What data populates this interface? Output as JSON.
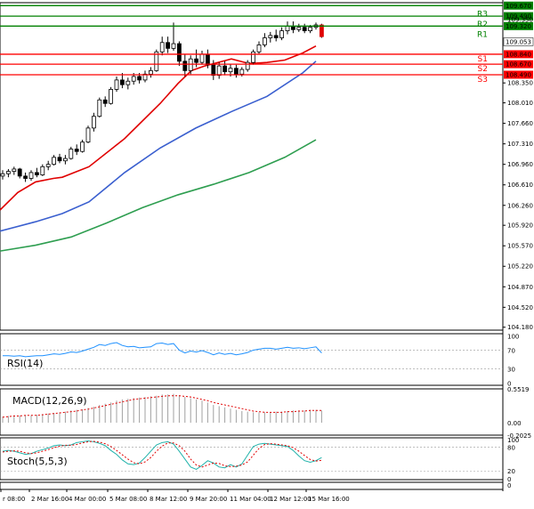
{
  "chart_data": {
    "type": "candlestick",
    "instrument_timeframe": "",
    "x_tick_labels": [
      "r 08:00",
      "2 Mar 16:00",
      "4 Mar 00:00",
      "5 Mar 08:00",
      "8 Mar 12:00",
      "9 Mar 20:00",
      "11 Mar 04:00",
      "12 Mar 12:00",
      "15 Mar 16:00"
    ],
    "price_ticks": [
      104.18,
      104.52,
      104.87,
      105.22,
      105.57,
      105.92,
      106.26,
      106.61,
      106.96,
      107.31,
      107.66,
      108.01,
      108.35
    ],
    "price_range": [
      104.13,
      109.72
    ],
    "last_price": 109.053,
    "levels": [
      {
        "name": "R3",
        "value": 109.67,
        "label": "109.670",
        "color": "#008000"
      },
      {
        "name": "R2",
        "value": 109.49,
        "label": "109.490",
        "color": "#008000"
      },
      {
        "name": "R1",
        "value": 109.32,
        "label": "109.320",
        "color": "#008000"
      },
      {
        "name": "S1",
        "value": 108.84,
        "label": "108.840",
        "color": "#ff0000"
      },
      {
        "name": "S2",
        "value": 108.67,
        "label": "108.670",
        "color": "#ff0000"
      },
      {
        "name": "S3",
        "value": 108.49,
        "label": "108.490",
        "color": "#ff0000"
      }
    ],
    "level_extra_label": "109.350",
    "candles": [
      [
        106.76,
        106.86,
        106.7,
        106.8
      ],
      [
        106.8,
        106.88,
        106.74,
        106.84
      ],
      [
        106.84,
        106.92,
        106.78,
        106.88
      ],
      [
        106.88,
        106.9,
        106.72,
        106.76
      ],
      [
        106.76,
        106.82,
        106.66,
        106.72
      ],
      [
        106.72,
        106.86,
        106.68,
        106.82
      ],
      [
        106.82,
        106.9,
        106.74,
        106.78
      ],
      [
        106.78,
        106.96,
        106.76,
        106.92
      ],
      [
        106.92,
        107.02,
        106.86,
        106.96
      ],
      [
        106.96,
        107.12,
        106.94,
        107.08
      ],
      [
        107.08,
        107.14,
        106.98,
        107.02
      ],
      [
        107.02,
        107.12,
        106.96,
        107.06
      ],
      [
        107.06,
        107.26,
        107.04,
        107.22
      ],
      [
        107.22,
        107.3,
        107.12,
        107.18
      ],
      [
        107.18,
        107.38,
        107.16,
        107.34
      ],
      [
        107.34,
        107.62,
        107.32,
        107.58
      ],
      [
        107.58,
        107.84,
        107.52,
        107.78
      ],
      [
        107.78,
        108.1,
        107.76,
        108.06
      ],
      [
        108.06,
        108.12,
        107.94,
        108.0
      ],
      [
        108.0,
        108.28,
        107.98,
        108.24
      ],
      [
        108.24,
        108.46,
        108.2,
        108.4
      ],
      [
        108.4,
        108.52,
        108.26,
        108.32
      ],
      [
        108.32,
        108.44,
        108.24,
        108.38
      ],
      [
        108.38,
        108.52,
        108.32,
        108.46
      ],
      [
        108.46,
        108.52,
        108.34,
        108.4
      ],
      [
        108.4,
        108.56,
        108.36,
        108.5
      ],
      [
        108.5,
        108.62,
        108.44,
        108.56
      ],
      [
        108.56,
        108.92,
        108.54,
        108.88
      ],
      [
        108.88,
        109.14,
        108.82,
        109.04
      ],
      [
        109.04,
        109.14,
        108.86,
        108.94
      ],
      [
        108.94,
        109.38,
        108.9,
        109.02
      ],
      [
        109.02,
        109.06,
        108.64,
        108.72
      ],
      [
        108.72,
        108.84,
        108.46,
        108.56
      ],
      [
        108.56,
        108.82,
        108.5,
        108.76
      ],
      [
        108.76,
        108.92,
        108.62,
        108.7
      ],
      [
        108.7,
        108.9,
        108.66,
        108.84
      ],
      [
        108.84,
        108.92,
        108.6,
        108.66
      ],
      [
        108.66,
        108.74,
        108.4,
        108.48
      ],
      [
        108.48,
        108.7,
        108.42,
        108.64
      ],
      [
        108.64,
        108.72,
        108.48,
        108.54
      ],
      [
        108.54,
        108.68,
        108.46,
        108.6
      ],
      [
        108.6,
        108.66,
        108.44,
        108.5
      ],
      [
        108.5,
        108.62,
        108.46,
        108.58
      ],
      [
        108.58,
        108.74,
        108.54,
        108.7
      ],
      [
        108.7,
        108.92,
        108.66,
        108.88
      ],
      [
        108.88,
        109.06,
        108.84,
        109.0
      ],
      [
        109.0,
        109.2,
        108.96,
        109.12
      ],
      [
        109.12,
        109.22,
        109.04,
        109.16
      ],
      [
        109.16,
        109.26,
        109.06,
        109.12
      ],
      [
        109.12,
        109.3,
        109.08,
        109.24
      ],
      [
        109.24,
        109.4,
        109.18,
        109.32
      ],
      [
        109.32,
        109.4,
        109.2,
        109.26
      ],
      [
        109.26,
        109.36,
        109.22,
        109.3
      ],
      [
        109.3,
        109.36,
        109.2,
        109.24
      ],
      [
        109.24,
        109.34,
        109.2,
        109.3
      ],
      [
        109.3,
        109.38,
        109.26,
        109.34
      ],
      [
        109.34,
        109.36,
        109.12,
        109.14
      ]
    ],
    "moving_averages": [
      {
        "color": "#e00000",
        "x": [
          0,
          20,
          40,
          60,
          70,
          100,
          140,
          180,
          200,
          215,
          230,
          260,
          280,
          300,
          320,
          340,
          355
        ],
        "y": [
          106.18,
          106.48,
          106.66,
          106.72,
          106.74,
          106.92,
          107.4,
          108.0,
          108.34,
          108.56,
          108.64,
          108.76,
          108.68,
          108.7,
          108.74,
          108.86,
          108.98
        ]
      },
      {
        "color": "#3a5fcf",
        "x": [
          0,
          40,
          70,
          100,
          140,
          180,
          220,
          260,
          300,
          340,
          355
        ],
        "y": [
          105.82,
          105.98,
          106.12,
          106.32,
          106.82,
          107.24,
          107.58,
          107.86,
          108.12,
          108.52,
          108.72
        ]
      },
      {
        "color": "#2e9e50",
        "x": [
          0,
          40,
          80,
          120,
          160,
          200,
          240,
          280,
          320,
          355
        ],
        "y": [
          105.48,
          105.58,
          105.72,
          105.96,
          106.22,
          106.44,
          106.62,
          106.82,
          107.08,
          107.38
        ]
      }
    ],
    "rsi": {
      "title": "RSI(14)",
      "ticks": [
        "100",
        "70",
        "30",
        "0"
      ],
      "tick_values": [
        100,
        70,
        30,
        0
      ],
      "values": [
        58,
        58,
        57,
        58,
        56,
        57,
        58,
        58,
        60,
        62,
        61,
        63,
        66,
        65,
        68,
        72,
        76,
        82,
        80,
        84,
        86,
        80,
        77,
        78,
        75,
        76,
        77,
        84,
        85,
        82,
        84,
        70,
        64,
        68,
        66,
        69,
        65,
        60,
        64,
        61,
        63,
        60,
        62,
        65,
        70,
        72,
        74,
        74,
        72,
        74,
        76,
        74,
        75,
        73,
        75,
        77,
        64
      ]
    },
    "macd": {
      "title": "MACD(12,26,9)",
      "ticks": [
        "0.5519",
        "0.00",
        "-0.2025"
      ],
      "tick_values": [
        0.5519,
        0.0,
        -0.2025
      ],
      "histogram": [
        0.1,
        0.11,
        0.12,
        0.12,
        0.12,
        0.12,
        0.13,
        0.14,
        0.15,
        0.16,
        0.17,
        0.18,
        0.2,
        0.21,
        0.22,
        0.24,
        0.26,
        0.29,
        0.31,
        0.33,
        0.36,
        0.38,
        0.39,
        0.4,
        0.41,
        0.42,
        0.43,
        0.44,
        0.46,
        0.46,
        0.47,
        0.45,
        0.42,
        0.4,
        0.38,
        0.36,
        0.33,
        0.29,
        0.27,
        0.25,
        0.23,
        0.21,
        0.19,
        0.18,
        0.17,
        0.17,
        0.17,
        0.17,
        0.18,
        0.18,
        0.19,
        0.2,
        0.2,
        0.2,
        0.21,
        0.21,
        0.2
      ],
      "signal": [
        0.09,
        0.1,
        0.11,
        0.11,
        0.12,
        0.12,
        0.12,
        0.13,
        0.14,
        0.15,
        0.16,
        0.17,
        0.18,
        0.19,
        0.21,
        0.22,
        0.24,
        0.26,
        0.28,
        0.3,
        0.32,
        0.34,
        0.36,
        0.38,
        0.39,
        0.4,
        0.41,
        0.42,
        0.43,
        0.44,
        0.44,
        0.44,
        0.43,
        0.42,
        0.4,
        0.38,
        0.36,
        0.33,
        0.31,
        0.29,
        0.27,
        0.25,
        0.23,
        0.21,
        0.19,
        0.18,
        0.17,
        0.17,
        0.17,
        0.17,
        0.18,
        0.18,
        0.19,
        0.19,
        0.2,
        0.2,
        0.2
      ]
    },
    "stoch": {
      "title": "Stoch(5,5,3)",
      "ticks": [
        "100",
        "80",
        "20",
        "0"
      ],
      "tick_values": [
        100,
        80,
        20,
        0
      ],
      "k": [
        70,
        72,
        70,
        66,
        62,
        64,
        70,
        74,
        78,
        84,
        86,
        84,
        86,
        92,
        94,
        96,
        94,
        90,
        84,
        72,
        62,
        48,
        38,
        36,
        40,
        54,
        70,
        86,
        92,
        94,
        88,
        70,
        50,
        30,
        24,
        34,
        46,
        40,
        30,
        28,
        36,
        30,
        38,
        60,
        82,
        88,
        90,
        88,
        86,
        84,
        82,
        72,
        58,
        46,
        42,
        46,
        54
      ],
      "d": [
        68,
        70,
        71,
        70,
        66,
        64,
        66,
        70,
        74,
        79,
        83,
        85,
        85,
        87,
        91,
        94,
        95,
        93,
        89,
        82,
        72,
        61,
        50,
        41,
        38,
        43,
        54,
        70,
        83,
        91,
        91,
        84,
        70,
        50,
        35,
        30,
        35,
        40,
        39,
        33,
        31,
        32,
        35,
        43,
        60,
        77,
        87,
        89,
        88,
        86,
        84,
        79,
        70,
        59,
        49,
        45,
        47
      ]
    }
  }
}
